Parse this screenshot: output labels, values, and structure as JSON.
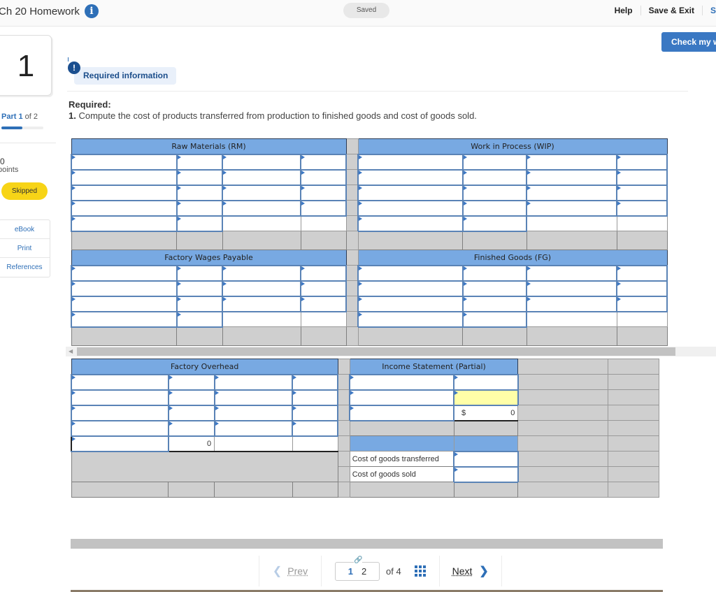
{
  "header": {
    "title": "Ch 20 Homework",
    "saved_status": "Saved",
    "links": [
      "Help",
      "Save & Exit",
      "S"
    ],
    "check_button": "Check my work"
  },
  "sidebar": {
    "question_number": "1",
    "part_label": "Part",
    "part_current": "1",
    "part_total_text": "of 2",
    "part_progress_fraction": 0.5,
    "points_value": "0",
    "points_label": "points",
    "status_badge": "Skipped",
    "resources": [
      "eBook",
      "Print",
      "References"
    ]
  },
  "question": {
    "info_badge": "Required information",
    "required_title": "Required:",
    "required_number": "1.",
    "required_text": "Compute the cost of products transferred from production to finished goods and cost of goods sold."
  },
  "accounts": {
    "raw_materials": "Raw Materials (RM)",
    "wip": "Work in Process (WIP)",
    "wages": "Factory Wages Payable",
    "finished_goods": "Finished Goods (FG)",
    "overhead": "Factory Overhead",
    "overhead_total": "0",
    "income_statement": "Income Statement (Partial)",
    "is_currency": "$",
    "is_total": "0",
    "cost_transferred_label": "Cost of goods transferred",
    "cogs_label": "Cost of goods sold"
  },
  "pager": {
    "prev": "Prev",
    "current": "1",
    "shown_page": "2",
    "of_text": "of 4",
    "next": "Next"
  }
}
